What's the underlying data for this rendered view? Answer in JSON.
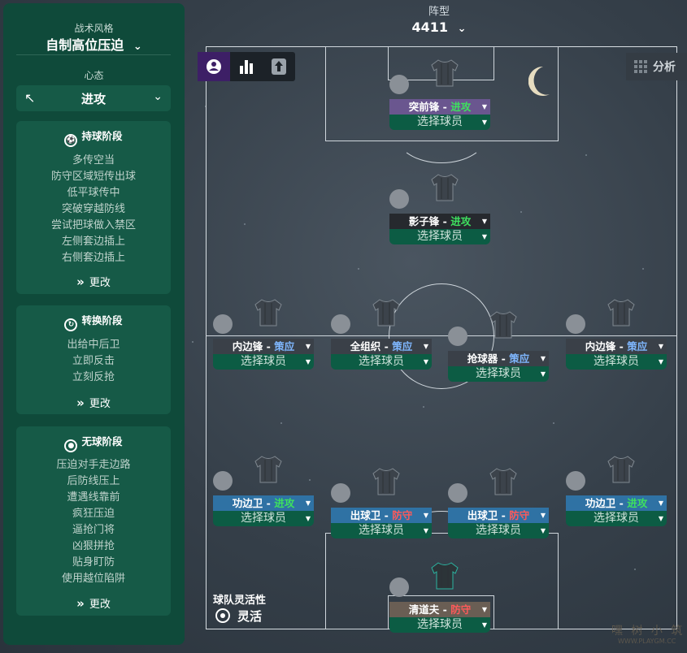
{
  "tactic": {
    "style_caption": "战术风格",
    "style_name": "自制高位压迫",
    "mentality_caption": "心态",
    "mentality_value": "进攻"
  },
  "phases": {
    "in_possession": {
      "title": "持球阶段",
      "items": [
        "多传空当",
        "防守区域短传出球",
        "低平球传中",
        "突破穿越防线",
        "尝试把球做入禁区",
        "左侧套边插上",
        "右侧套边插上"
      ],
      "change_label": "更改"
    },
    "transition": {
      "title": "转换阶段",
      "items": [
        "出给中后卫",
        "立即反击",
        "立刻反抢"
      ],
      "change_label": "更改"
    },
    "out_of_possession": {
      "title": "无球阶段",
      "items": [
        "压迫对手走边路",
        "后防线压上",
        "遭遇线靠前",
        "疯狂压迫",
        "逼抢门将",
        "凶狠拼抢",
        "贴身盯防",
        "使用越位陷阱"
      ],
      "change_label": "更改"
    }
  },
  "formation": {
    "caption": "阵型",
    "value": "4411"
  },
  "analysis_label": "分析",
  "pick_label": "选择球员",
  "duties": {
    "attack": "进攻",
    "support": "策应",
    "defend": "防守"
  },
  "duty_colors": {
    "attack": "#3ee05f",
    "support": "#7fb7ff",
    "defend": "#ff5a5a"
  },
  "positions": {
    "st": {
      "role": "突前锋",
      "duty": "进攻"
    },
    "am": {
      "role": "影子锋",
      "duty": "进攻"
    },
    "lm": {
      "role": "内边锋",
      "duty": "策应"
    },
    "lcm": {
      "role": "全组织",
      "duty": "策应"
    },
    "rcm": {
      "role": "抢球器",
      "duty": "策应"
    },
    "rm": {
      "role": "内边锋",
      "duty": "策应"
    },
    "lb": {
      "role": "功边卫",
      "duty": "进攻"
    },
    "lcb": {
      "role": "出球卫",
      "duty": "防守"
    },
    "rcb": {
      "role": "出球卫",
      "duty": "防守"
    },
    "rb": {
      "role": "功边卫",
      "duty": "进攻"
    },
    "gk": {
      "role": "清道夫",
      "duty": "防守"
    }
  },
  "team_fluidity": {
    "caption": "球队灵活性",
    "value": "灵活"
  },
  "watermark": {
    "text": "嘿 树 小 筑",
    "sub": "WWW.PLAYGM.CC"
  }
}
